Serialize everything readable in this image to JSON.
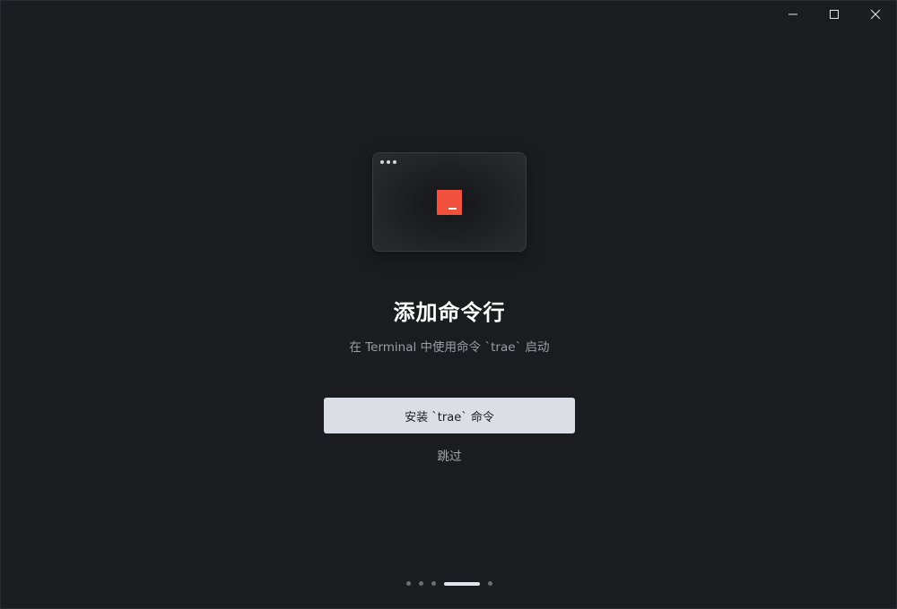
{
  "window_controls": {
    "minimize_icon": "minimize-icon",
    "maximize_icon": "maximize-icon",
    "close_icon": "close-icon"
  },
  "illustration": {
    "icon": "terminal-icon",
    "accent_color": "#f2513e"
  },
  "main": {
    "title": "添加命令行",
    "subtitle": "在 Terminal 中使用命令 `trae` 启动",
    "install_button_label": "安装 `trae` 命令",
    "skip_label": "跳过"
  },
  "pager": {
    "total_steps": 5,
    "current_step": 4
  },
  "colors": {
    "background": "#1b1c20",
    "button_background": "#dcdee6",
    "title_text": "#ffffff",
    "muted_text": "#9c9da3"
  }
}
